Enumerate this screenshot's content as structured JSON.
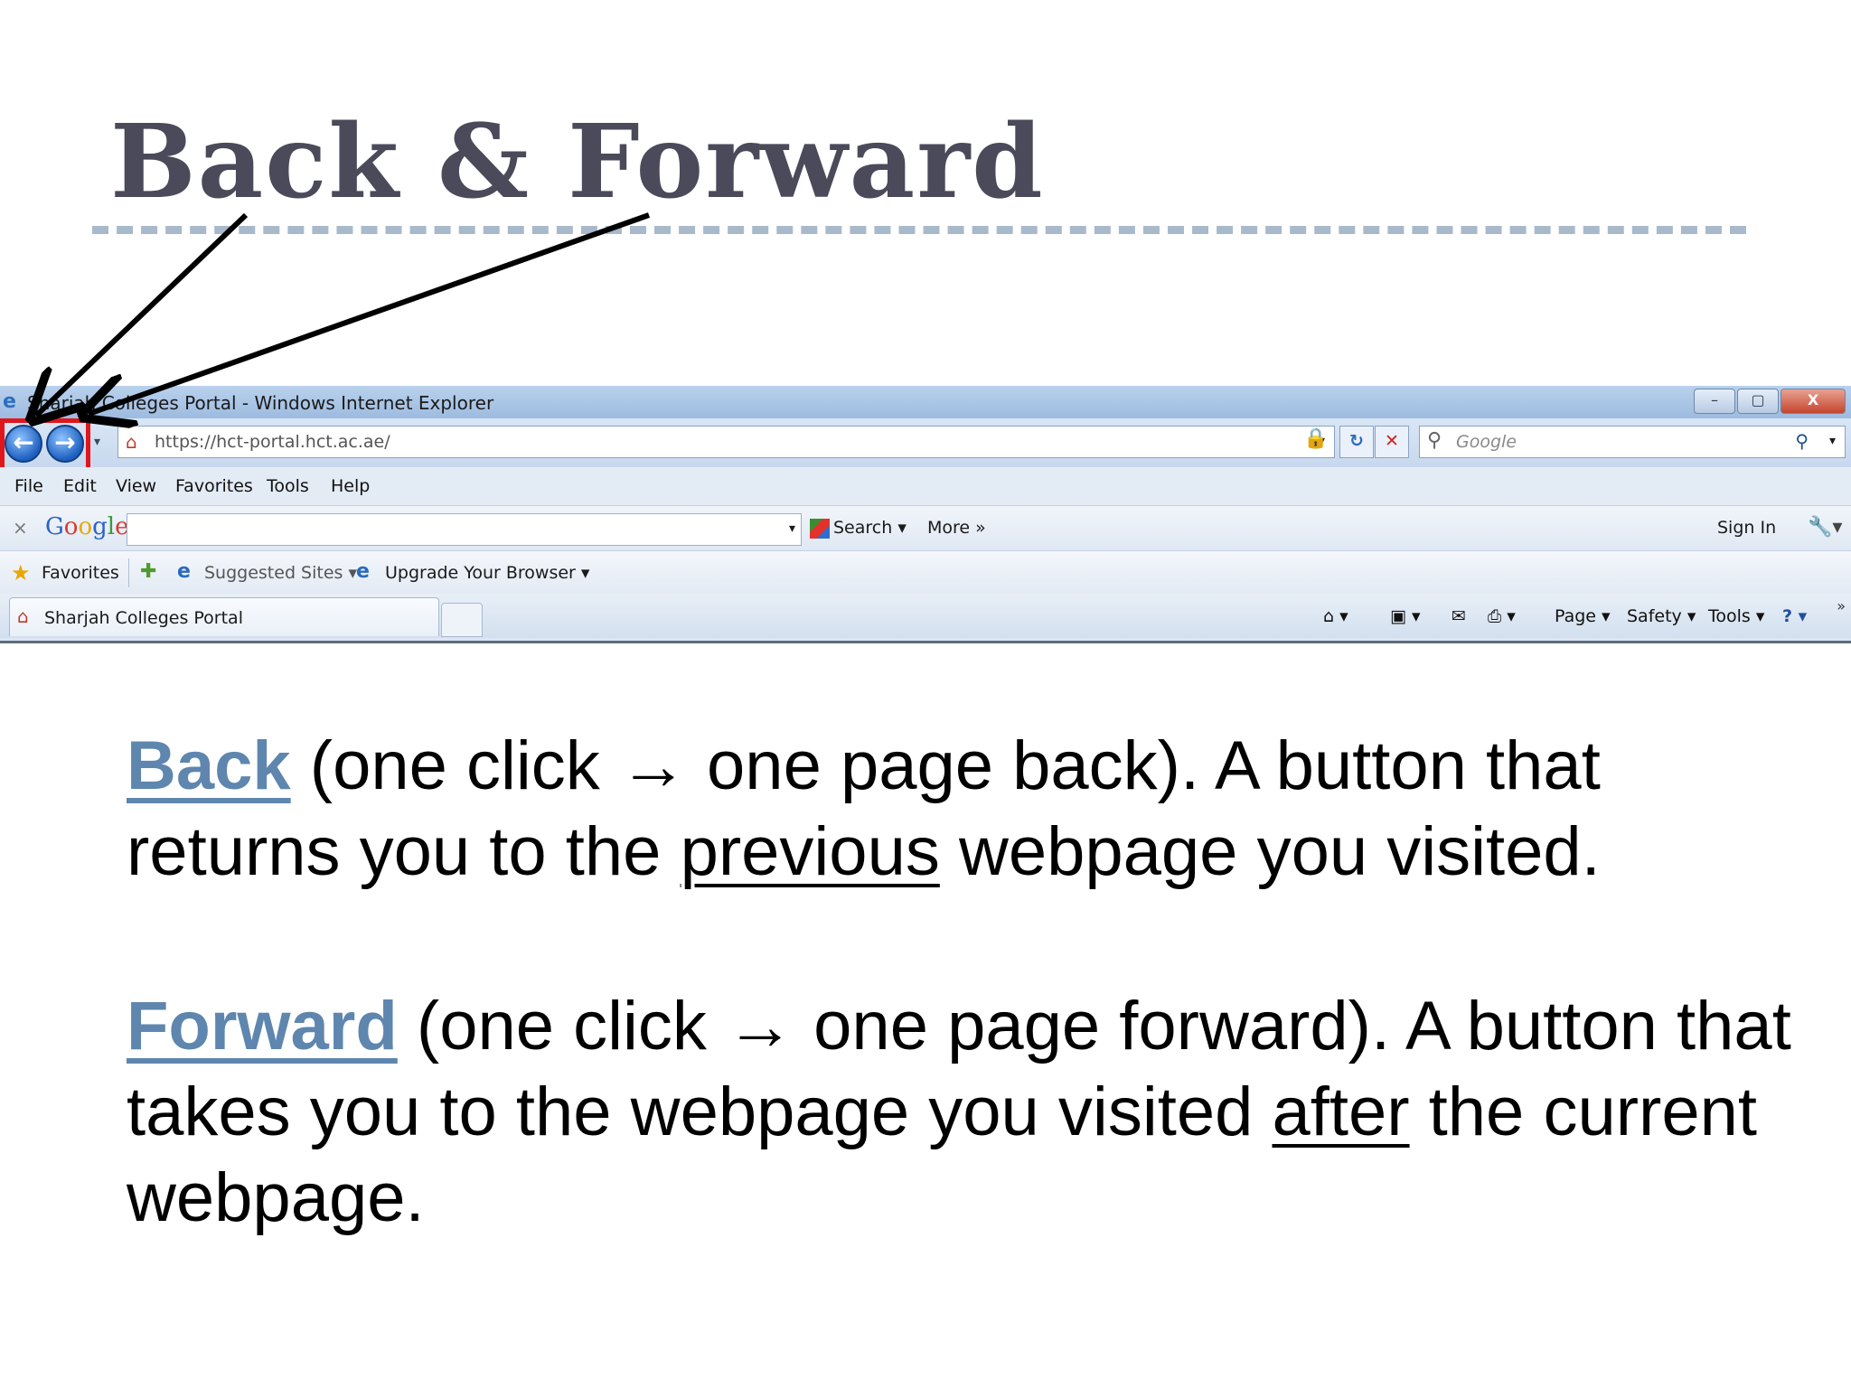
{
  "slide": {
    "title": "Back & Forward",
    "colors": {
      "title": "#4a4a5a",
      "keyword": "#5e86ae",
      "rule": "#a9b9cc",
      "highlight": "#e0161c"
    }
  },
  "browser": {
    "window_title": "Sharjah Colleges Portal - Windows Internet Explorer",
    "window_buttons": {
      "minimize": "–",
      "restore": "▢",
      "close": "X"
    },
    "nav": {
      "back_glyph": "←",
      "forward_glyph": "→",
      "history_glyph": "▾"
    },
    "address": {
      "url": "https://hct-portal.hct.ac.ae/",
      "dropdown": "▾"
    },
    "security": {
      "lock_glyph": "🔒",
      "refresh_glyph": "↻",
      "stop_glyph": "✕"
    },
    "search": {
      "placeholder": "Google",
      "go_glyph": "⚲",
      "dropdown": "▾"
    },
    "menu": [
      "File",
      "Edit",
      "View",
      "Favorites",
      "Tools",
      "Help"
    ],
    "google_toolbar": {
      "close": "×",
      "logo_letters": [
        {
          "ch": "G",
          "color": "#2a62c9"
        },
        {
          "ch": "o",
          "color": "#d63b2f"
        },
        {
          "ch": "o",
          "color": "#e8a800"
        },
        {
          "ch": "g",
          "color": "#2a62c9"
        },
        {
          "ch": "l",
          "color": "#3a9a3a"
        },
        {
          "ch": "e",
          "color": "#d63b2f"
        }
      ],
      "input_dropdown": "▾",
      "search_label": "Search ▾",
      "more_label": "More »",
      "sign_in": "Sign In",
      "wrench_glyph": "🔧▾"
    },
    "favorites_bar": {
      "favorites": "Favorites",
      "suggested": "Suggested Sites ▾",
      "upgrade": "Upgrade Your Browser ▾",
      "star_glyph": "★",
      "add_glyph": "✚",
      "ie_glyph": "e"
    },
    "tab": {
      "title": "Sharjah Colleges Portal"
    },
    "command_bar": {
      "home": "⌂ ▾",
      "feeds": "▣ ▾",
      "mail": "✉",
      "print": "⎙ ▾",
      "page": "Page ▾",
      "safety": "Safety ▾",
      "tools": "Tools ▾",
      "help": "? ▾",
      "chevron": "»"
    }
  },
  "content": {
    "p1": {
      "keyword": "Back",
      "part1": " (one click → one page back).  A button that returns you to the ",
      "underlined": "previous",
      "part2": " webpage you visited."
    },
    "p2": {
      "keyword": "Forward",
      "part1": " (one click → one page forward).  A button that takes you to the webpage you visited ",
      "underlined": "after",
      "part2": " the current webpage."
    }
  }
}
